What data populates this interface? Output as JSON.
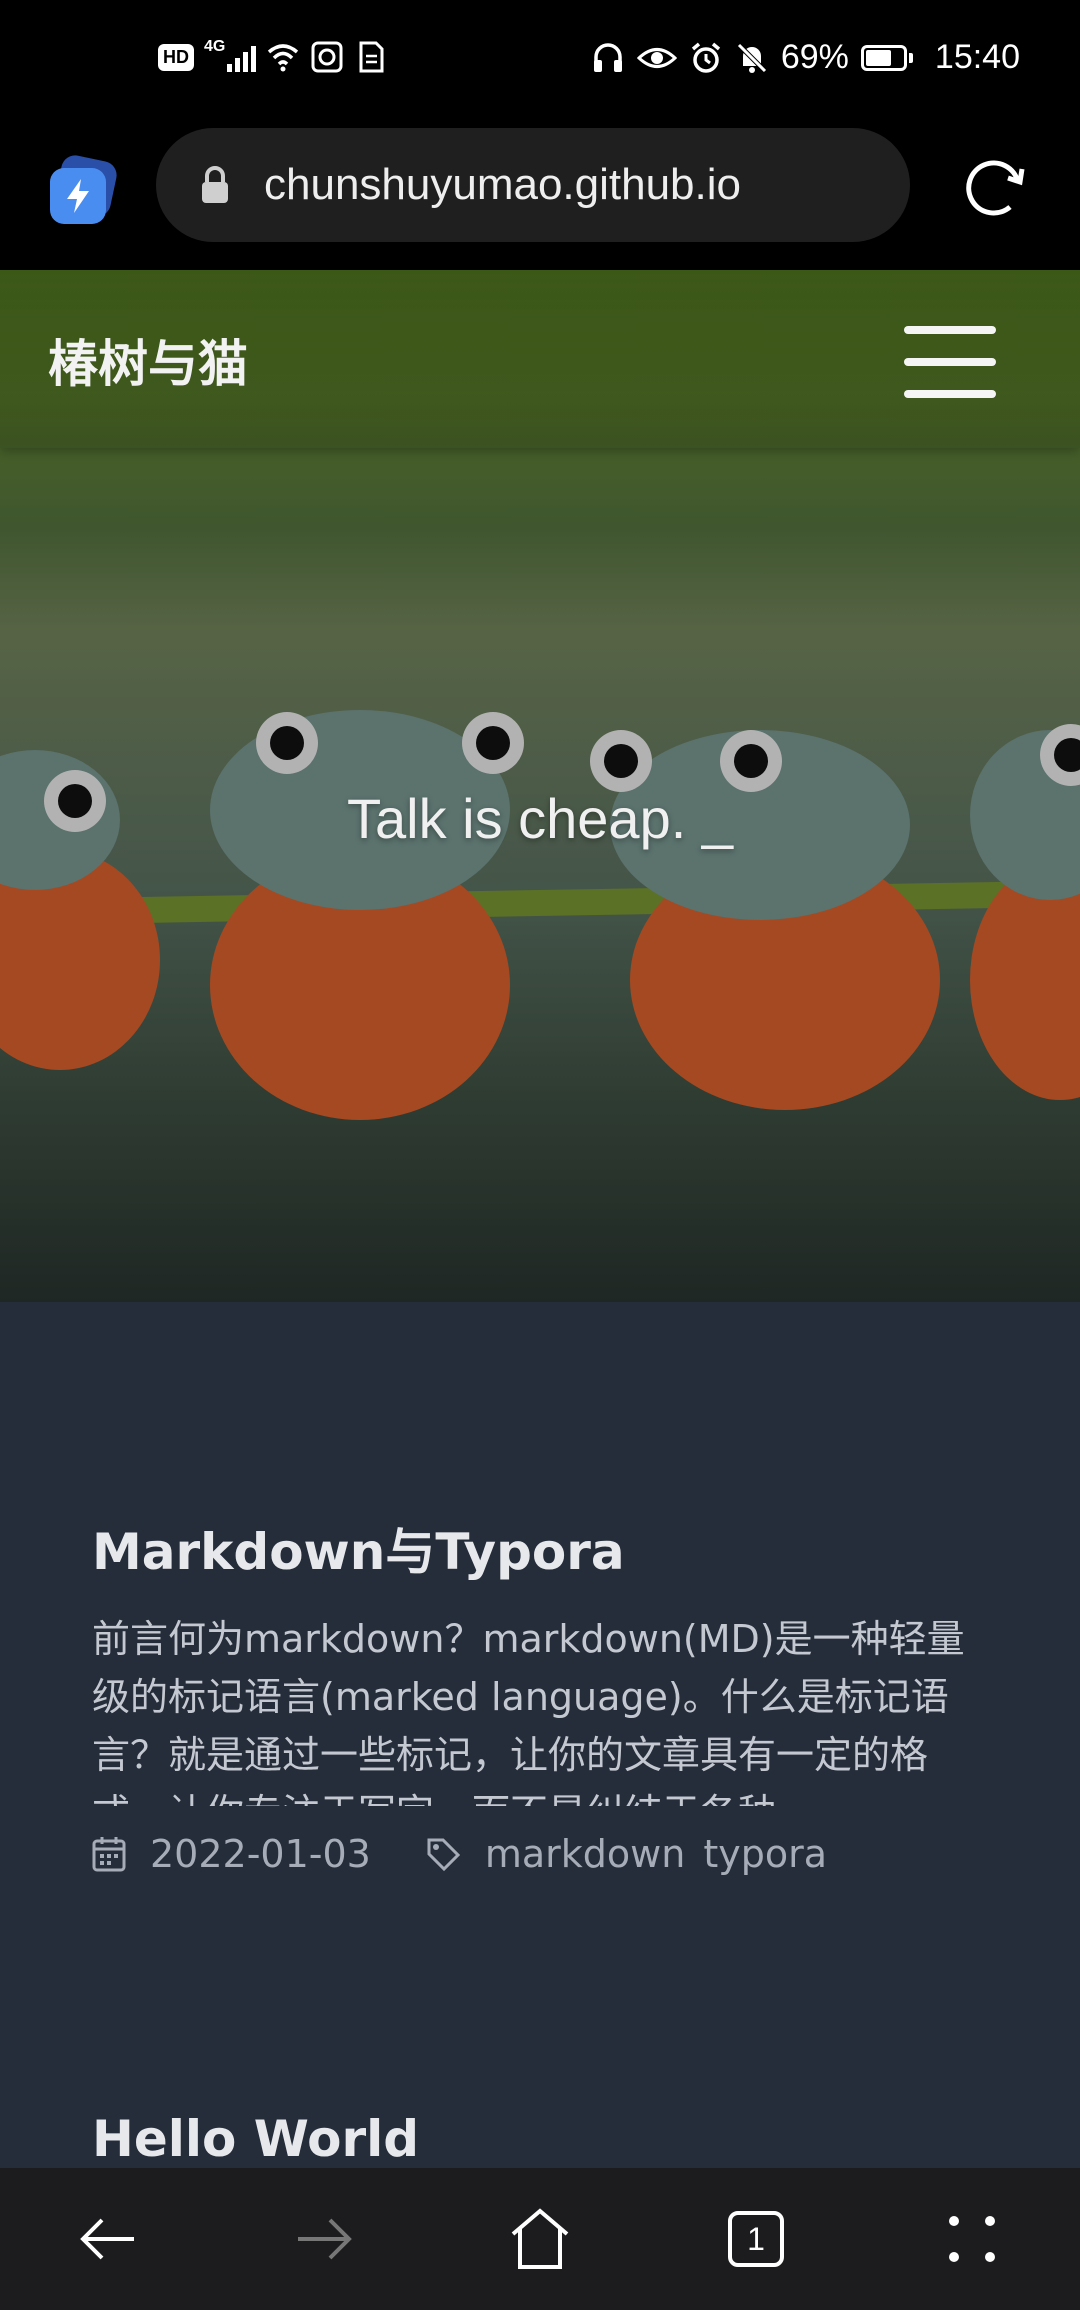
{
  "status_bar": {
    "network_badge": "HD",
    "network_type": "4G",
    "battery_percent": "69%",
    "battery_level": 0.69,
    "time": "15:40",
    "icons": [
      "hd-icon",
      "signal-icon",
      "wifi-icon",
      "nfc-icon",
      "sim-icon",
      "headphones-icon",
      "eye-icon",
      "alarm-icon",
      "mute-icon",
      "battery-icon"
    ]
  },
  "browser": {
    "url": "chunshuyumao.github.io",
    "icons": [
      "app-badge-icon",
      "lock-icon",
      "reload-icon"
    ]
  },
  "site": {
    "title": "椿树与猫",
    "tagline": "Talk is cheap. _"
  },
  "posts": [
    {
      "title": "Markdown与Typora",
      "excerpt": "前言何为markdown？markdown(MD)是一种轻量级的标记语言(marked language)。什么是标记语言？就是通过一些标记，让你的文章具有一定的格式，让你专注于写字，而不是纠结于各种",
      "date": "2022-01-03",
      "tags": [
        "markdown",
        "typora"
      ]
    },
    {
      "title": "Hello World"
    }
  ],
  "bottom_nav": {
    "tab_count": "1",
    "icons": [
      "back-icon",
      "forward-icon",
      "home-icon",
      "tabs-icon",
      "more-icon"
    ]
  }
}
